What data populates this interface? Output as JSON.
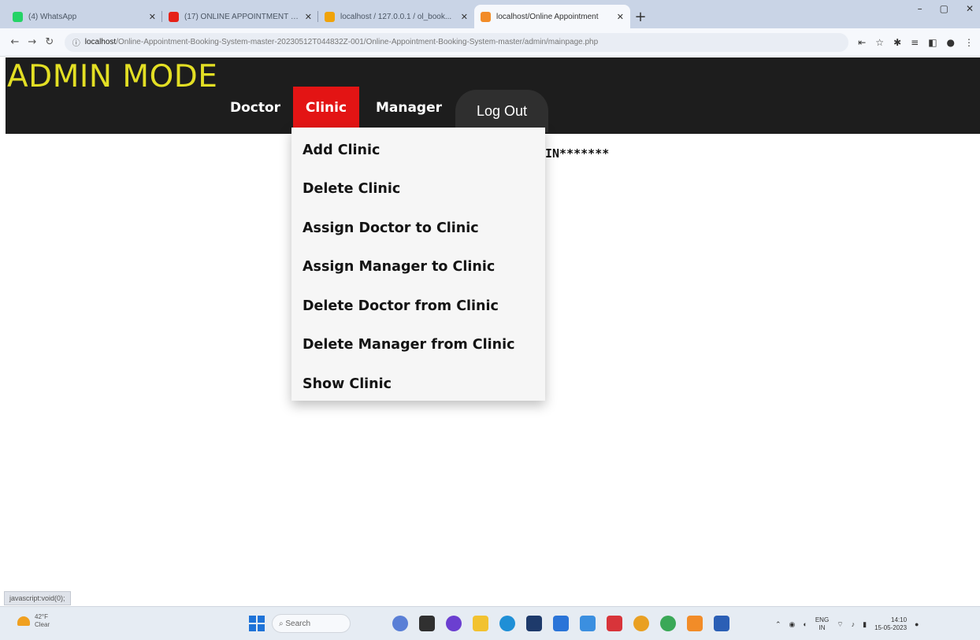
{
  "browser": {
    "tabs": [
      {
        "label": "(4) WhatsApp",
        "favicon_color": "#25d366",
        "active": false
      },
      {
        "label": "(17) ONLINE APPOINTMENT B...",
        "favicon_color": "#e62117",
        "active": false
      },
      {
        "label": "localhost / 127.0.0.1 / ol_book...",
        "favicon_color": "#f0a30a",
        "active": false
      },
      {
        "label": "localhost/Online Appointment",
        "favicon_color": "#f28c28",
        "active": true
      }
    ],
    "new_tab_label": "+",
    "window_controls": {
      "minimize": "–",
      "maximize": "▢",
      "close": "✕"
    },
    "address": {
      "host": "localhost",
      "path": "/Online-Appointment-Booking-System-master-20230512T044832Z-001/Online-Appointment-Booking-System-master/admin/mainpage.php"
    },
    "status_url": "javascript:void(0);"
  },
  "header": {
    "brand": "ADMIN MODE",
    "brand_color": "#e3df24",
    "nav": {
      "doctor": "Doctor",
      "clinic": "Clinic",
      "manager": "Manager",
      "logout": "Log Out"
    },
    "active_color": "#e31414"
  },
  "dropdown": {
    "items": [
      "Add Clinic",
      "Delete Clinic",
      "Assign Doctor to Clinic",
      "Assign Manager to Clinic",
      "Delete Doctor from Clinic",
      "Delete Manager from Clinic",
      "Show Clinic"
    ]
  },
  "welcome_partial": "IN*******",
  "taskbar": {
    "weather_temp": "42°F",
    "weather_desc": "Clear",
    "search_label": "Search",
    "tray_lang_top": "ENG",
    "tray_lang_bottom": "IN",
    "time": "14:10",
    "date": "15-05-2023"
  }
}
